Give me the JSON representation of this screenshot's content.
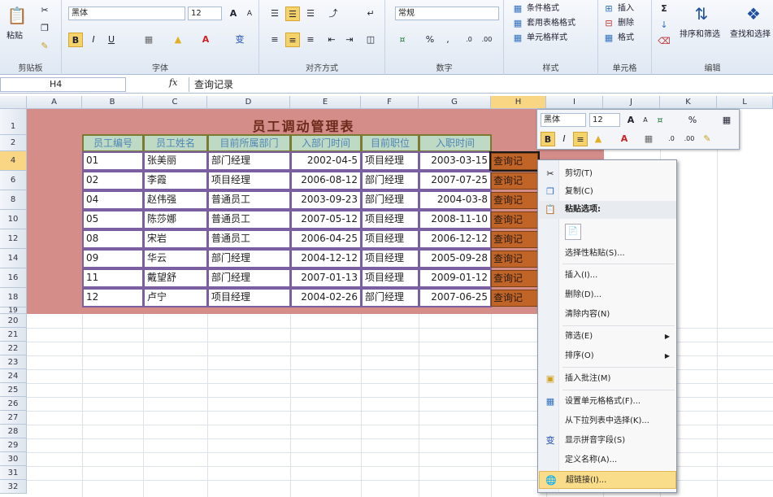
{
  "ribbon": {
    "clipboard": {
      "paste": "粘贴",
      "label": "剪贴板"
    },
    "font": {
      "name": "黑体",
      "size": "12",
      "bold": "B",
      "italic": "I",
      "underline": "U",
      "grow": "A",
      "shrink": "A",
      "pinyin": "变",
      "label": "字体"
    },
    "align": {
      "wrap": "",
      "label": "对齐方式"
    },
    "number": {
      "format": "常规",
      "percent": "%",
      "comma": ",",
      "label": "数字"
    },
    "styles": {
      "conditional": "条件格式",
      "table": "套用表格格式",
      "cell": "单元格样式",
      "label": "样式"
    },
    "cells": {
      "insert": "插入",
      "delete": "删除",
      "format": "格式",
      "label": "单元格"
    },
    "editing": {
      "sigma": "Σ",
      "sort": "排序和筛选",
      "find": "查找和选择",
      "label": "编辑"
    }
  },
  "formula_bar": {
    "name_box": "H4",
    "fx": "fx",
    "content": "查询记录"
  },
  "sheet": {
    "columns": [
      "A",
      "B",
      "C",
      "D",
      "E",
      "F",
      "G",
      "H",
      "I",
      "J",
      "K",
      "L"
    ],
    "rows": [
      "1",
      "2",
      "4",
      "6",
      "8",
      "10",
      "12",
      "14",
      "16",
      "18",
      "19",
      "20",
      "21",
      "22",
      "23",
      "24",
      "25",
      "26",
      "27",
      "28",
      "29",
      "30",
      "31",
      "32"
    ],
    "title": "员工调动管理表",
    "headers": [
      "员工编号",
      "员工姓名",
      "目前所属部门",
      "入部门时间",
      "目前职位",
      "入职时间"
    ],
    "records": [
      [
        "01",
        "张美丽",
        "部门经理",
        "2002-04-5",
        "项目经理",
        "2003-03-15",
        "查询记"
      ],
      [
        "02",
        "李霞",
        "项目经理",
        "2006-08-12",
        "部门经理",
        "2007-07-25",
        "查询记"
      ],
      [
        "04",
        "赵伟强",
        "普通员工",
        "2003-09-23",
        "部门经理",
        "2004-03-8",
        "查询记"
      ],
      [
        "05",
        "陈莎娜",
        "普通员工",
        "2007-05-12",
        "项目经理",
        "2008-11-10",
        "查询记"
      ],
      [
        "08",
        "宋岩",
        "普通员工",
        "2006-04-25",
        "项目经理",
        "2006-12-12",
        "查询记"
      ],
      [
        "09",
        "华云",
        "部门经理",
        "2004-12-12",
        "项目经理",
        "2005-09-28",
        "查询记"
      ],
      [
        "11",
        "戴望舒",
        "部门经理",
        "2007-01-13",
        "项目经理",
        "2009-01-12",
        "查询记"
      ],
      [
        "12",
        "卢宁",
        "项目经理",
        "2004-02-26",
        "部门经理",
        "2007-06-25",
        "查询记"
      ]
    ]
  },
  "mini_toolbar": {
    "font": "黑体",
    "size": "12",
    "percent": "%"
  },
  "context_menu": {
    "items": [
      "剪切(T)",
      "复制(C)",
      "粘贴选项:",
      "",
      "选择性粘贴(S)...",
      "插入(I)...",
      "删除(D)...",
      "清除内容(N)",
      "筛选(E)",
      "排序(O)",
      "插入批注(M)",
      "设置单元格格式(F)...",
      "从下拉列表中选择(K)...",
      "显示拼音字段(S)",
      "定义名称(A)...",
      "超链接(I)..."
    ]
  }
}
